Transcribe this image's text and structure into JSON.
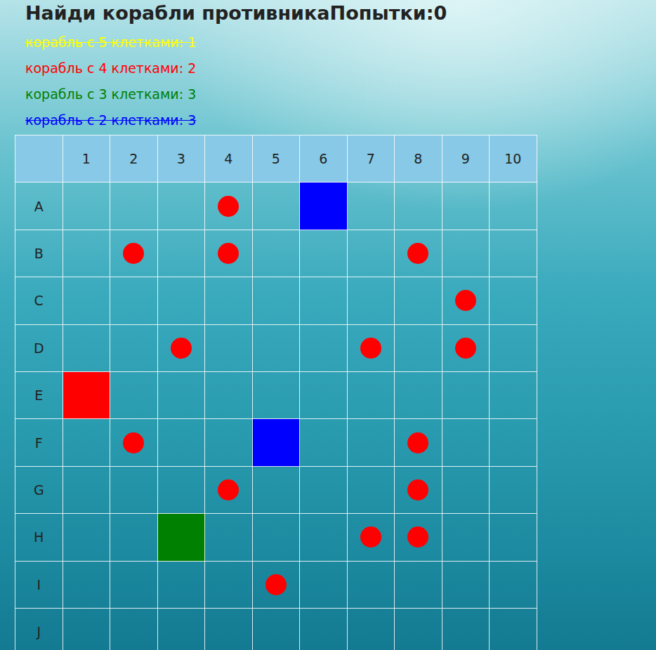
{
  "header": {
    "title": "Найди корабли противника",
    "attempts": "Попытки:0"
  },
  "legend": [
    {
      "text": "корабль с 5 клетками: 1",
      "color": "#ffff00",
      "sunk": true
    },
    {
      "text": "корабль с 4 клетками: 2",
      "color": "#ff0000",
      "sunk": false
    },
    {
      "text": "корабль с 3 клетками: 3",
      "color": "#008000",
      "sunk": false
    },
    {
      "text": "корабль с 2 клетками: 3",
      "color": "#0000ff",
      "sunk": true
    }
  ],
  "board": {
    "columns": [
      "1",
      "2",
      "3",
      "4",
      "5",
      "6",
      "7",
      "8",
      "9",
      "10"
    ],
    "rows": [
      {
        "label": "A",
        "cells": [
          {
            "kind": "empty"
          },
          {
            "kind": "empty"
          },
          {
            "kind": "empty"
          },
          {
            "kind": "miss"
          },
          {
            "kind": "empty"
          },
          {
            "kind": "hit",
            "color": "#0000ff"
          },
          {
            "kind": "empty"
          },
          {
            "kind": "empty"
          },
          {
            "kind": "empty"
          },
          {
            "kind": "empty"
          }
        ]
      },
      {
        "label": "B",
        "cells": [
          {
            "kind": "empty"
          },
          {
            "kind": "miss"
          },
          {
            "kind": "empty"
          },
          {
            "kind": "miss"
          },
          {
            "kind": "empty"
          },
          {
            "kind": "empty"
          },
          {
            "kind": "empty"
          },
          {
            "kind": "miss"
          },
          {
            "kind": "empty"
          },
          {
            "kind": "empty"
          }
        ]
      },
      {
        "label": "C",
        "cells": [
          {
            "kind": "empty"
          },
          {
            "kind": "empty"
          },
          {
            "kind": "empty"
          },
          {
            "kind": "empty"
          },
          {
            "kind": "empty"
          },
          {
            "kind": "empty"
          },
          {
            "kind": "empty"
          },
          {
            "kind": "empty"
          },
          {
            "kind": "miss"
          },
          {
            "kind": "empty"
          }
        ]
      },
      {
        "label": "D",
        "cells": [
          {
            "kind": "empty"
          },
          {
            "kind": "empty"
          },
          {
            "kind": "miss"
          },
          {
            "kind": "empty"
          },
          {
            "kind": "empty"
          },
          {
            "kind": "empty"
          },
          {
            "kind": "miss"
          },
          {
            "kind": "empty"
          },
          {
            "kind": "miss"
          },
          {
            "kind": "empty"
          }
        ]
      },
      {
        "label": "E",
        "cells": [
          {
            "kind": "hit",
            "color": "#ff0000"
          },
          {
            "kind": "empty"
          },
          {
            "kind": "empty"
          },
          {
            "kind": "empty"
          },
          {
            "kind": "empty"
          },
          {
            "kind": "empty"
          },
          {
            "kind": "empty"
          },
          {
            "kind": "empty"
          },
          {
            "kind": "empty"
          },
          {
            "kind": "empty"
          }
        ]
      },
      {
        "label": "F",
        "cells": [
          {
            "kind": "empty"
          },
          {
            "kind": "miss"
          },
          {
            "kind": "empty"
          },
          {
            "kind": "empty"
          },
          {
            "kind": "hit",
            "color": "#0000ff"
          },
          {
            "kind": "empty"
          },
          {
            "kind": "empty"
          },
          {
            "kind": "miss"
          },
          {
            "kind": "empty"
          },
          {
            "kind": "empty"
          }
        ]
      },
      {
        "label": "G",
        "cells": [
          {
            "kind": "empty"
          },
          {
            "kind": "empty"
          },
          {
            "kind": "empty"
          },
          {
            "kind": "miss"
          },
          {
            "kind": "empty"
          },
          {
            "kind": "empty"
          },
          {
            "kind": "empty"
          },
          {
            "kind": "miss"
          },
          {
            "kind": "empty"
          },
          {
            "kind": "empty"
          }
        ]
      },
      {
        "label": "H",
        "cells": [
          {
            "kind": "empty"
          },
          {
            "kind": "empty"
          },
          {
            "kind": "hit",
            "color": "#008000"
          },
          {
            "kind": "empty"
          },
          {
            "kind": "empty"
          },
          {
            "kind": "empty"
          },
          {
            "kind": "miss"
          },
          {
            "kind": "miss"
          },
          {
            "kind": "empty"
          },
          {
            "kind": "empty"
          }
        ]
      },
      {
        "label": "I",
        "cells": [
          {
            "kind": "empty"
          },
          {
            "kind": "empty"
          },
          {
            "kind": "empty"
          },
          {
            "kind": "empty"
          },
          {
            "kind": "miss"
          },
          {
            "kind": "empty"
          },
          {
            "kind": "empty"
          },
          {
            "kind": "empty"
          },
          {
            "kind": "empty"
          },
          {
            "kind": "empty"
          }
        ]
      },
      {
        "label": "J",
        "cells": [
          {
            "kind": "empty"
          },
          {
            "kind": "empty"
          },
          {
            "kind": "empty"
          },
          {
            "kind": "empty"
          },
          {
            "kind": "empty"
          },
          {
            "kind": "empty"
          },
          {
            "kind": "empty"
          },
          {
            "kind": "empty"
          },
          {
            "kind": "empty"
          },
          {
            "kind": "empty"
          }
        ]
      }
    ]
  }
}
